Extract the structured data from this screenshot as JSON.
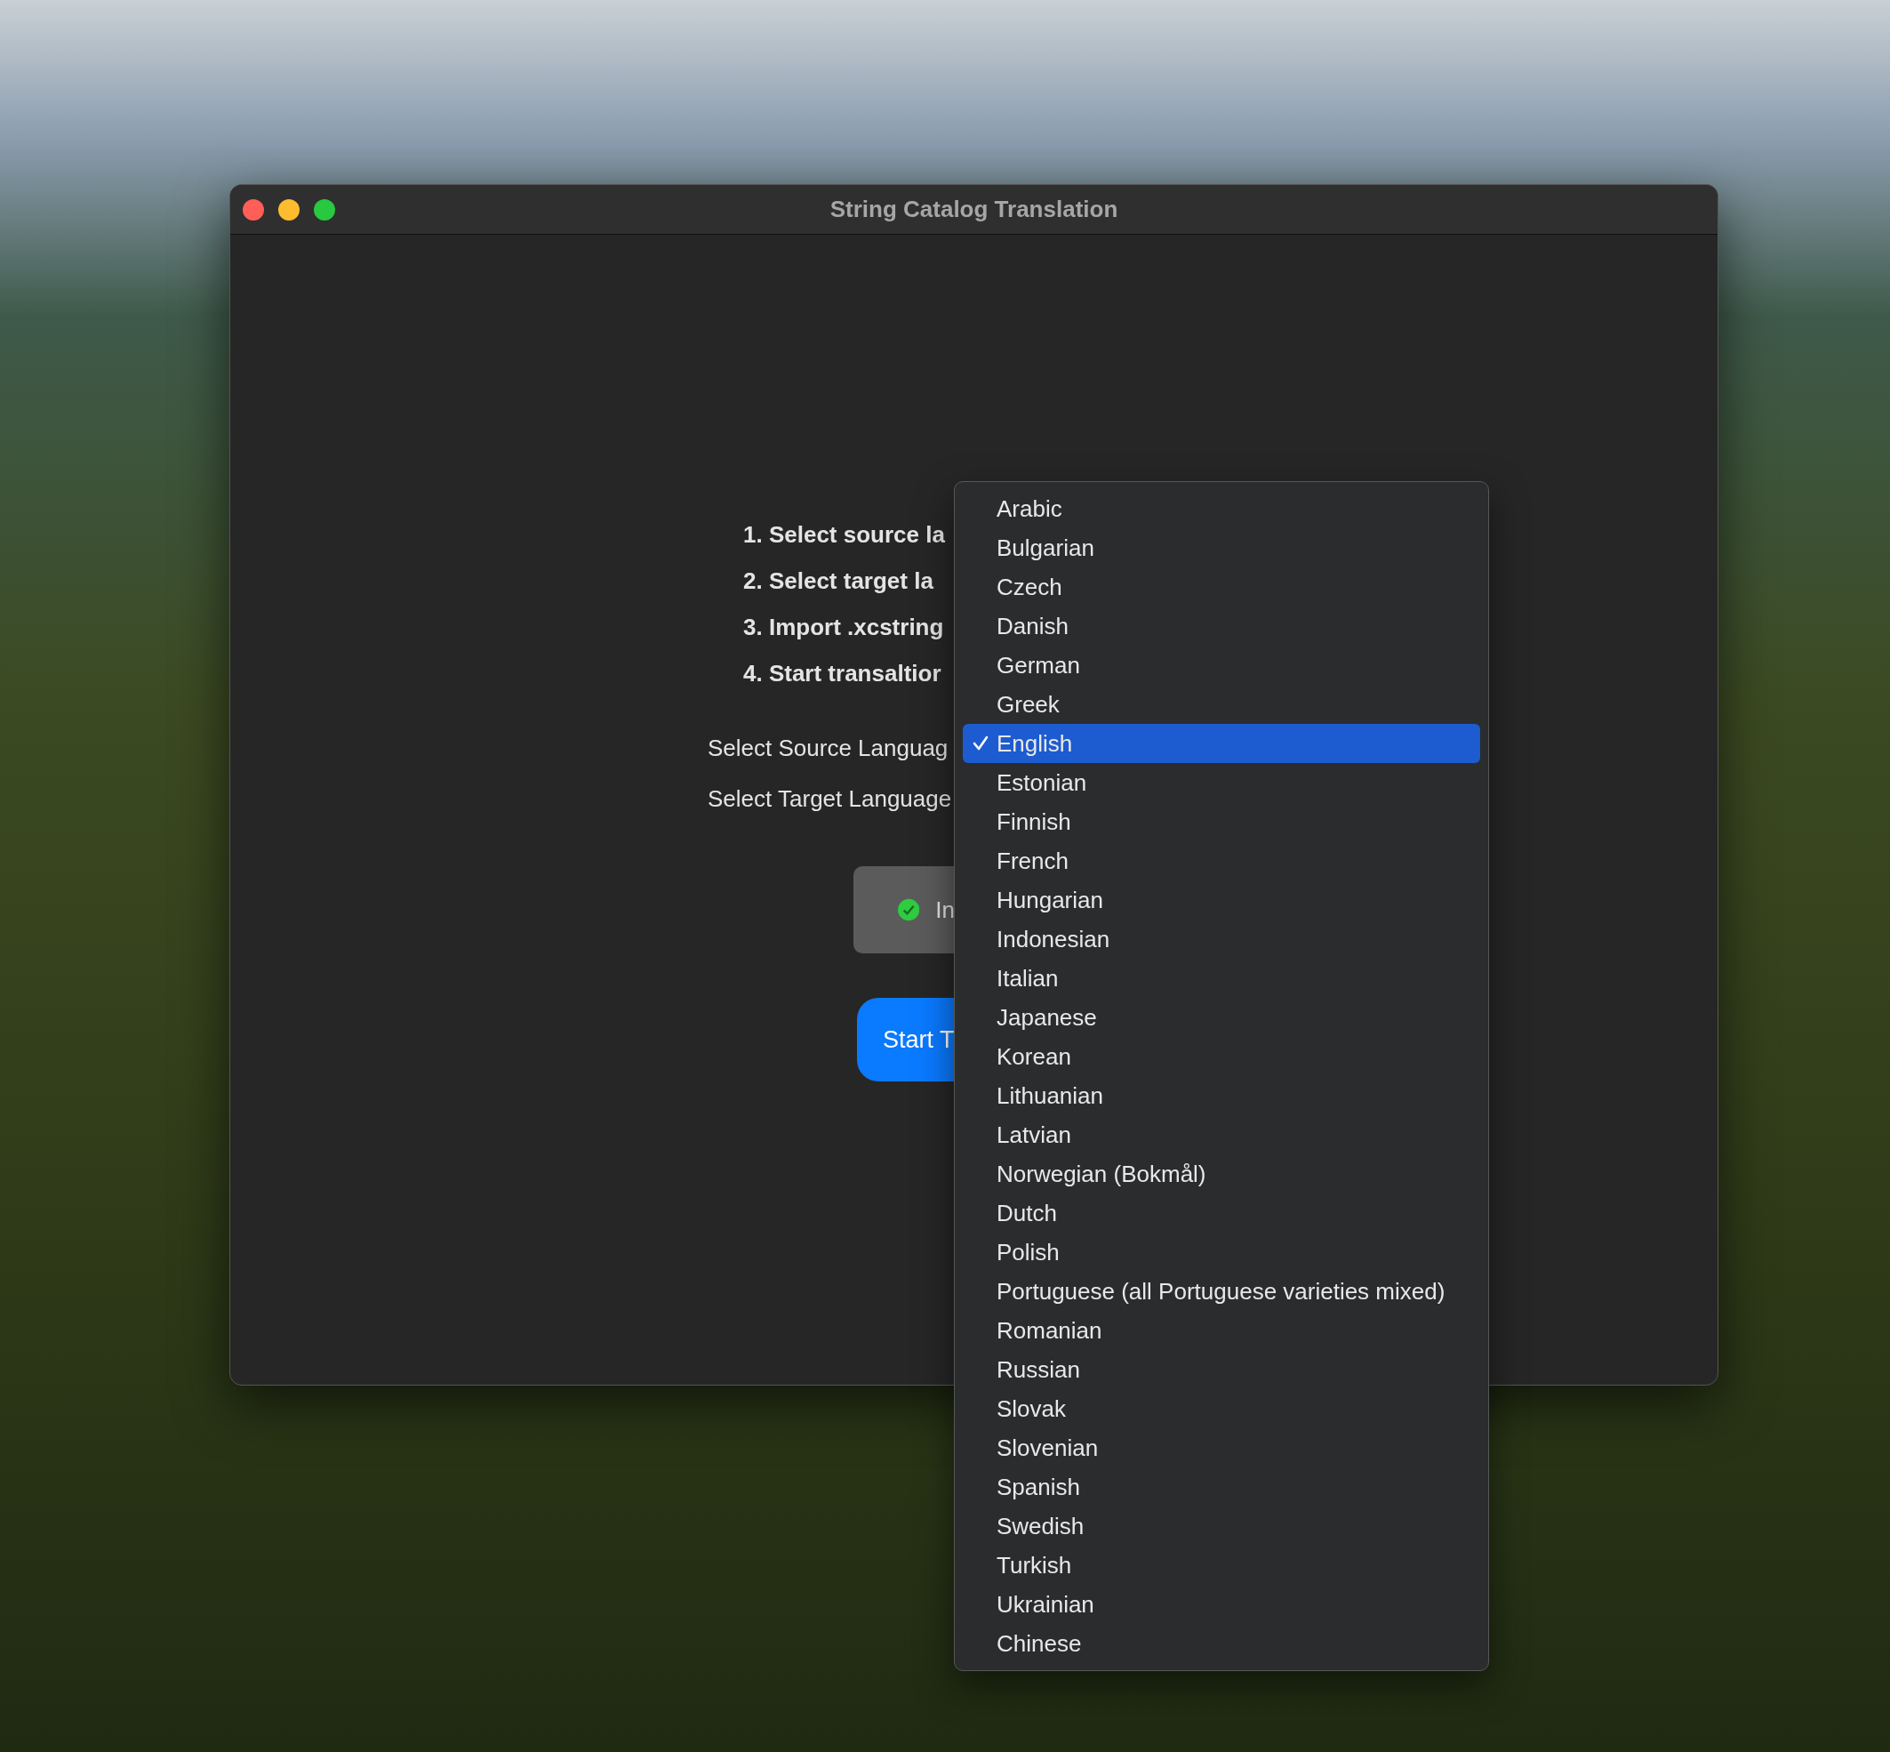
{
  "window": {
    "title": "String Catalog Translation"
  },
  "steps": [
    "1. Select source la",
    "2. Select target la",
    "3. Import .xcstring",
    "4. Start transaltior"
  ],
  "fields": [
    {
      "label": "Select Source Languag"
    },
    {
      "label": "Select Target Language"
    }
  ],
  "import_button": {
    "label": "In",
    "imported": true
  },
  "start_button": {
    "label": "Start T"
  },
  "menu": {
    "items": [
      {
        "label": "Arabic",
        "selected": false
      },
      {
        "label": "Bulgarian",
        "selected": false
      },
      {
        "label": "Czech",
        "selected": false
      },
      {
        "label": "Danish",
        "selected": false
      },
      {
        "label": "German",
        "selected": false
      },
      {
        "label": "Greek",
        "selected": false
      },
      {
        "label": "English",
        "selected": true
      },
      {
        "label": "Estonian",
        "selected": false
      },
      {
        "label": "Finnish",
        "selected": false
      },
      {
        "label": "French",
        "selected": false
      },
      {
        "label": "Hungarian",
        "selected": false
      },
      {
        "label": "Indonesian",
        "selected": false
      },
      {
        "label": "Italian",
        "selected": false
      },
      {
        "label": "Japanese",
        "selected": false
      },
      {
        "label": "Korean",
        "selected": false
      },
      {
        "label": "Lithuanian",
        "selected": false
      },
      {
        "label": "Latvian",
        "selected": false
      },
      {
        "label": "Norwegian (Bokmål)",
        "selected": false
      },
      {
        "label": "Dutch",
        "selected": false
      },
      {
        "label": "Polish",
        "selected": false
      },
      {
        "label": "Portuguese (all Portuguese varieties mixed)",
        "selected": false
      },
      {
        "label": "Romanian",
        "selected": false
      },
      {
        "label": "Russian",
        "selected": false
      },
      {
        "label": "Slovak",
        "selected": false
      },
      {
        "label": "Slovenian",
        "selected": false
      },
      {
        "label": "Spanish",
        "selected": false
      },
      {
        "label": "Swedish",
        "selected": false
      },
      {
        "label": "Turkish",
        "selected": false
      },
      {
        "label": "Ukrainian",
        "selected": false
      },
      {
        "label": "Chinese",
        "selected": false
      }
    ]
  }
}
